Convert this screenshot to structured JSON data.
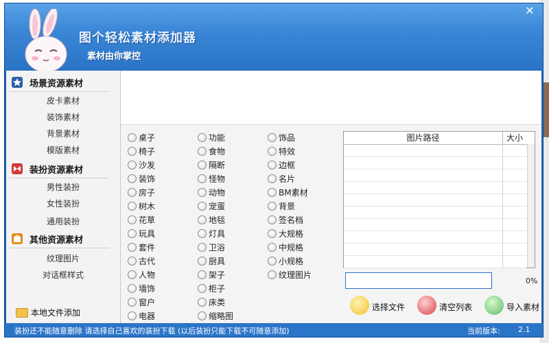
{
  "app": {
    "title": "图个轻松素材添加器",
    "subtitle": "素材由你掌控",
    "close_label": "✕"
  },
  "sidebar": {
    "sections": [
      {
        "label": "场景资源素材",
        "icon": "star-icon",
        "color": "#2d5fa8",
        "items": [
          "皮卡素材",
          "装饰素材",
          "背景素材",
          "模版素材"
        ]
      },
      {
        "label": "装扮资源素材",
        "icon": "bow-icon",
        "color": "#d13a3a",
        "items": [
          "男性装扮",
          "女性装扮",
          "通用装扮"
        ]
      },
      {
        "label": "其他资源素材",
        "icon": "box-icon",
        "color": "#e08a1c",
        "items": [
          "纹理图片",
          "对话框样式"
        ]
      }
    ],
    "local_add_label": "本地文件添加"
  },
  "categories": {
    "col1": [
      "桌子",
      "椅子",
      "沙发",
      "装饰",
      "房子",
      "树木",
      "花草",
      "玩具",
      "套件",
      "古代",
      "人物",
      "墙饰",
      "窗户",
      "电器"
    ],
    "col2": [
      "功能",
      "食物",
      "隔断",
      "怪物",
      "动物",
      "宠蛋",
      "地毯",
      "灯具",
      "卫浴",
      "厨具",
      "架子",
      "柜子",
      "床类",
      "缩略图"
    ],
    "col3": [
      "饰品",
      "特效",
      "边框",
      "名片",
      "BM素材",
      "背景",
      "签名档",
      "大规格",
      "中规格",
      "小规格",
      "纹理图片"
    ]
  },
  "table": {
    "col_path": "图片路径",
    "col_size": "大小"
  },
  "progress": {
    "percent_label": "0%",
    "value": 0
  },
  "actions": {
    "choose_file": "选择文件",
    "clear_list": "清空列表",
    "import": "导入素材"
  },
  "status": {
    "message": "装扮还不能随意删除 请选择自己喜欢的装扮下载 (以后装扮只能下载不可随意添加)",
    "version_label": "当前版本:",
    "version": "2.1"
  },
  "colors": {
    "window_blue": "#2a74c6",
    "status_blue": "#2b75c8",
    "sidebar_bg": "#f3f3f3"
  }
}
